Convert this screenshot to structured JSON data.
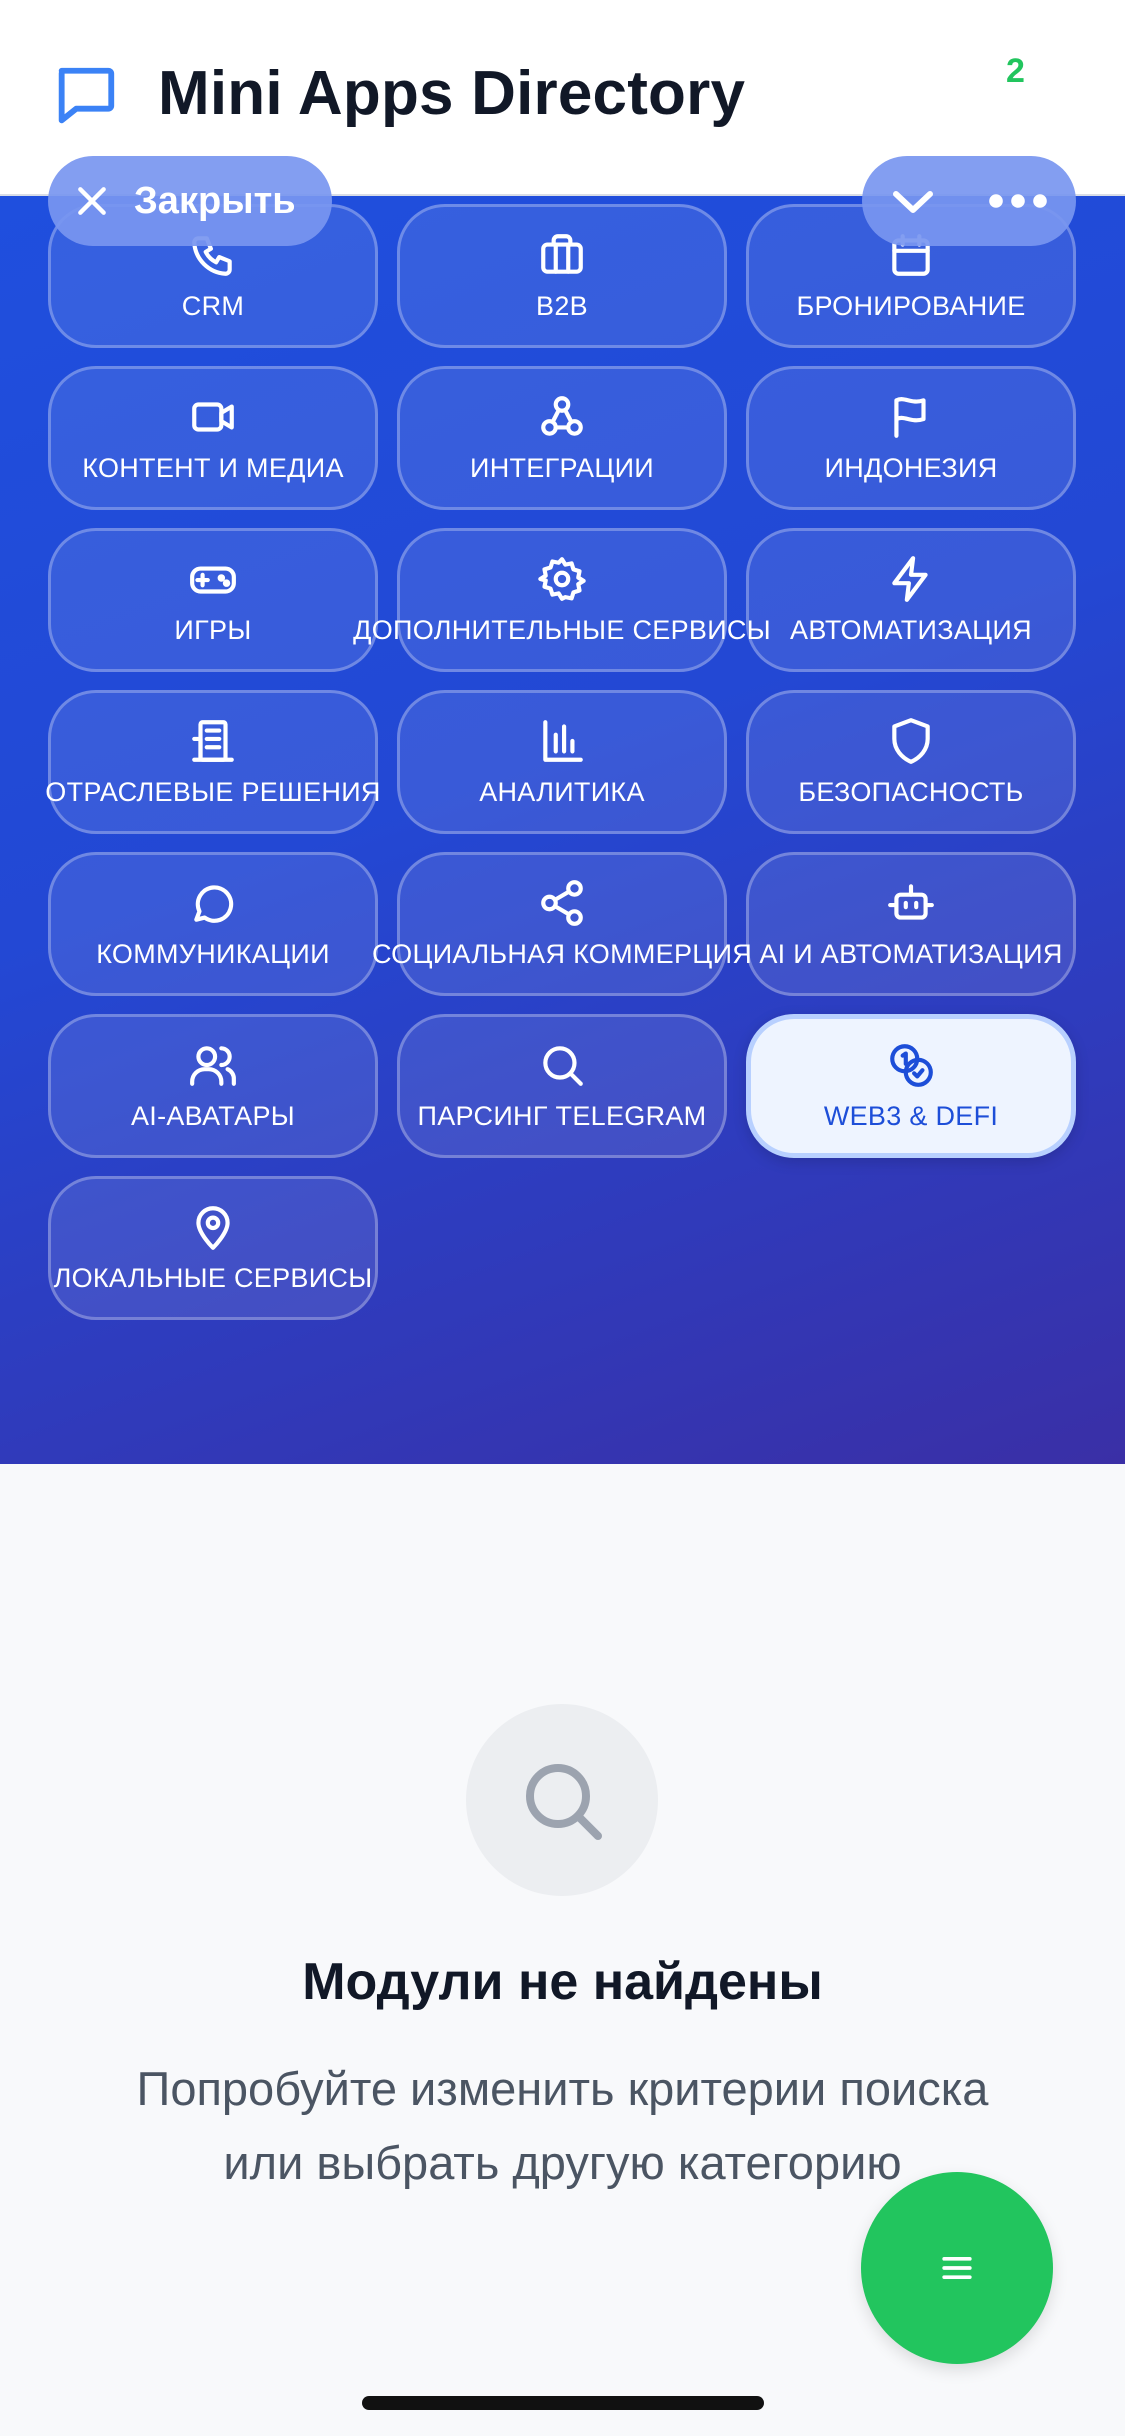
{
  "header": {
    "title": "Mini Apps Directory",
    "badge": "2",
    "app_icon": "chat-bubble-icon"
  },
  "overlay": {
    "close_label": "Закрыть",
    "close_icon": "close-icon",
    "collapse_icon": "chevron-down-icon",
    "more_icon": "more-dots-icon"
  },
  "categories": [
    {
      "label": "CRM",
      "icon": "phone-icon",
      "active": false
    },
    {
      "label": "B2B",
      "icon": "briefcase-icon",
      "active": false
    },
    {
      "label": "БРОНИРОВАНИЕ",
      "icon": "calendar-icon",
      "active": false
    },
    {
      "label": "КОНТЕНТ И МЕДИА",
      "icon": "video-icon",
      "active": false
    },
    {
      "label": "ИНТЕГРАЦИИ",
      "icon": "webhook-icon",
      "active": false
    },
    {
      "label": "ИНДОНЕЗИЯ",
      "icon": "flag-icon",
      "active": false
    },
    {
      "label": "ИГРЫ",
      "icon": "gamepad-icon",
      "active": false
    },
    {
      "label": "ДОПОЛНИТЕЛЬНЫЕ СЕРВИСЫ",
      "icon": "gear-icon",
      "active": false
    },
    {
      "label": "АВТОМАТИЗАЦИЯ",
      "icon": "lightning-icon",
      "active": false
    },
    {
      "label": "ОТРАСЛЕВЫЕ РЕШЕНИЯ",
      "icon": "building-icon",
      "active": false
    },
    {
      "label": "АНАЛИТИКА",
      "icon": "bar-chart-icon",
      "active": false
    },
    {
      "label": "БЕЗОПАСНОСТЬ",
      "icon": "shield-icon",
      "active": false
    },
    {
      "label": "КОММУНИКАЦИИ",
      "icon": "message-circle-icon",
      "active": false
    },
    {
      "label": "СОЦИАЛЬНАЯ КОММЕРЦИЯ",
      "icon": "share-icon",
      "active": false
    },
    {
      "label": "AI И АВТОМАТИЗАЦИЯ",
      "icon": "robot-icon",
      "active": false
    },
    {
      "label": "AI-АВАТАРЫ",
      "icon": "users-icon",
      "active": false
    },
    {
      "label": "ПАРСИНГ TELEGRAM",
      "icon": "search-icon",
      "active": false
    },
    {
      "label": "WEB3 & DEFI",
      "icon": "coins-icon",
      "active": true
    },
    {
      "label": "ЛОКАЛЬНЫЕ СЕРВИСЫ",
      "icon": "map-pin-icon",
      "active": false
    }
  ],
  "empty_state": {
    "icon": "search-icon",
    "title": "Модули не найдены",
    "line1": "Попробуйте изменить критерии поиска",
    "line2": "или выбрать другую категорию"
  },
  "fab": {
    "icon": "menu-icon"
  },
  "colors": {
    "panel_start": "#1f4fde",
    "panel_end": "#3a2fa6",
    "active_chip_text": "#1d4ed8",
    "fab": "#22c55e",
    "badge": "#22c55e"
  }
}
